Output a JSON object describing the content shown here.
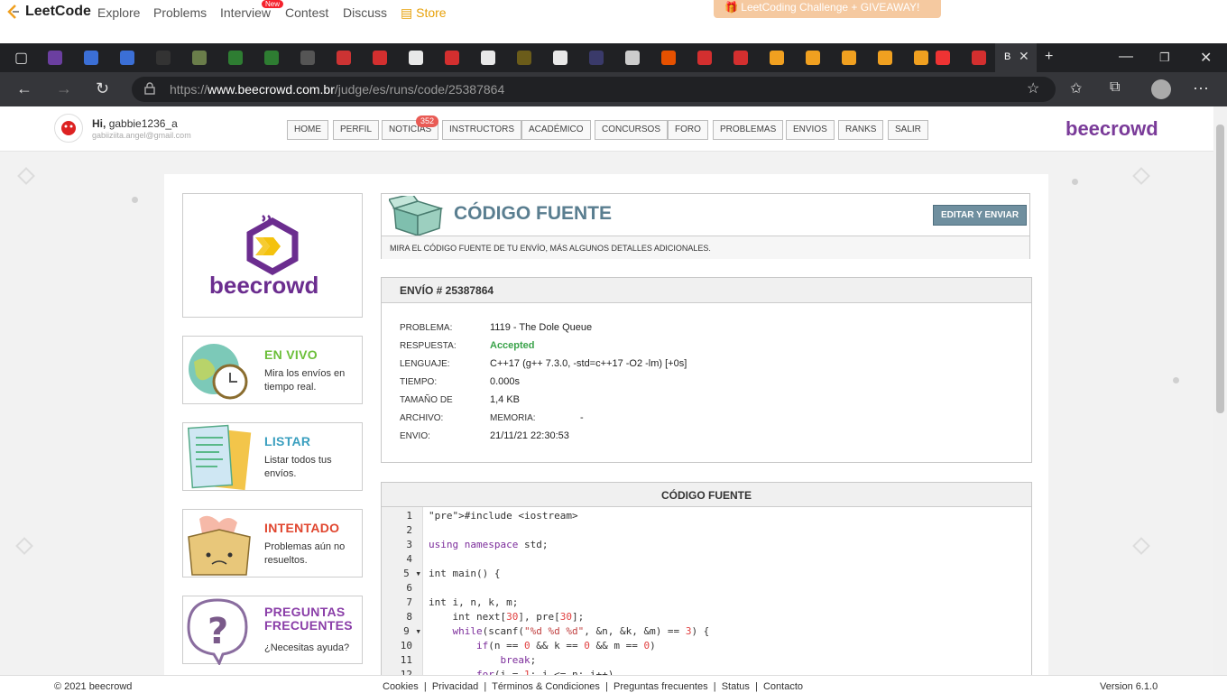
{
  "leetcode": {
    "logo_text": "LeetCode",
    "nav": [
      "Explore",
      "Problems",
      "Interview",
      "Contest",
      "Discuss"
    ],
    "new_badge": "New",
    "store": "Store",
    "promo": "LeetCoding Challenge + GIVEAWAY!"
  },
  "browser": {
    "url_prefix": "https://",
    "url_host": "www.beecrowd.com.br",
    "url_path": "/judge/es/runs/code/25387864",
    "active_tab_letter": "B"
  },
  "header": {
    "greeting": "Hi,",
    "username": "gabbie1236_a",
    "email": "gabiiziita.angel@gmail.com",
    "menu": [
      "HOME",
      "PERFIL",
      "NOTICIAS",
      "INSTRUCTORS",
      "ACADÉMICO",
      "CONCURSOS",
      "FORO",
      "PROBLEMAS",
      "ENVIOS",
      "RANKS",
      "SALIR"
    ],
    "news_badge": "352",
    "brand": "beecrowd"
  },
  "left": {
    "logo_text": "beecrowd",
    "panels": [
      {
        "title": "EN VIVO",
        "desc": "Mira los envíos en tiempo real.",
        "color": "#6cbf3a"
      },
      {
        "title": "LISTAR",
        "desc": "Listar todos tus envíos.",
        "color": "#3a9fbf"
      },
      {
        "title": "INTENTADO",
        "desc": "Problemas aún no resueltos.",
        "color": "#e0452e"
      },
      {
        "title": "PREGUNTAS FRECUENTES",
        "desc": "¿Necesitas ayuda?",
        "color": "#8a3ea8"
      }
    ]
  },
  "source": {
    "title": "CÓDIGO FUENTE",
    "subtitle": "MIRA EL CÓDIGO FUENTE DE TU ENVÍO, MÁS ALGUNOS DETALLES ADICIONALES.",
    "edit_button": "EDITAR Y ENVIAR"
  },
  "submission": {
    "header": "ENVÍO # 25387864",
    "rows": [
      {
        "k": "PROBLEMA:",
        "v": "1119 - The Dole Queue"
      },
      {
        "k": "RESPUESTA:",
        "v": "Accepted"
      },
      {
        "k": "LENGUAJE:",
        "v": "C++17 (g++ 7.3.0, -std=c++17 -O2 -lm) [+0s]"
      },
      {
        "k": "TIEMPO:",
        "v": "0.000s"
      },
      {
        "k": "TAMAÑO DE",
        "v": "1,4 KB"
      },
      {
        "k": "ARCHIVO:",
        "v": "MEMORIA:"
      },
      {
        "k": "ENVIO:",
        "v": "21/11/21 22:30:53"
      }
    ],
    "memory_value": "-"
  },
  "code": {
    "header": "CÓDIGO FUENTE",
    "lines": [
      "#include <iostream>",
      "",
      "using namespace std;",
      "",
      "int main() {",
      "",
      "int i, n, k, m;",
      "    int next[30], pre[30];",
      "    while(scanf(\"%d %d %d\", &n, &k, &m) == 3) {",
      "        if(n == 0 && k == 0 && m == 0)",
      "            break;",
      "        for(i = 1; i <= n; i++)"
    ]
  },
  "footer": {
    "copyright": "© 2021 beecrowd",
    "links": [
      "Cookies",
      "Privacidad",
      "Términos & Condiciones",
      "Preguntas frecuentes",
      "Status",
      "Contacto"
    ],
    "version": "Version 6.1.0"
  }
}
